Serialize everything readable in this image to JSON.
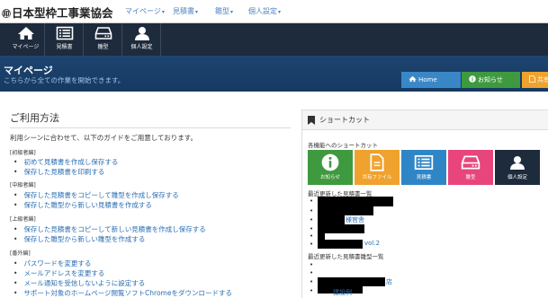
{
  "brand": {
    "seal": "㊞",
    "name": "日本型枠工事業協会"
  },
  "nav": [
    {
      "label": "マイページ"
    },
    {
      "label": "見積書"
    },
    {
      "label": "雛型"
    },
    {
      "label": "個人設定"
    }
  ],
  "iconbar": [
    {
      "label": "マイページ",
      "icon": "home-icon"
    },
    {
      "label": "見積書",
      "icon": "list-icon"
    },
    {
      "label": "雛型",
      "icon": "drive-icon"
    },
    {
      "label": "個人設定",
      "icon": "user-icon"
    }
  ],
  "header": {
    "title": "マイページ",
    "subtitle": "こちらから全ての作業を開始できます。",
    "buttons": [
      {
        "label": "Home",
        "color": "#3a87c8",
        "icon": "home-icon"
      },
      {
        "label": "お知らせ",
        "color": "#3f9a3f",
        "icon": "info-icon"
      },
      {
        "label": "共有",
        "color": "#f0a22e",
        "icon": "file-icon"
      }
    ]
  },
  "usage": {
    "heading": "ご利用方法",
    "intro": "利用シーンに合わせて、以下のガイドをご用意しております。",
    "sections": [
      {
        "title": "[初級者編]",
        "items": [
          "初めて見積書を作成し保存する",
          "保存した見積書を印刷する"
        ]
      },
      {
        "title": "[中級者編]",
        "items": [
          "保存した見積書をコピーして雛型を作成し保存する",
          "保存した雛型から新しい見積書を作成する"
        ]
      },
      {
        "title": "[上級者編]",
        "items": [
          "保存した見積書をコピーして新しい見積書を作成し保存する",
          "保存した雛型から新しい雛型を作成する"
        ]
      },
      {
        "title": "[番外編]",
        "items": [
          "パスワードを変更する",
          "メールアドレスを変更する",
          "メール通知を受信しないように設定する",
          "サポート対象のホームページ閲覧ソフトChromeをダウンロードする"
        ]
      }
    ]
  },
  "shortcut": {
    "title": "ショートカット",
    "all_label": "各機能へのショートカット",
    "buttons": [
      {
        "label": "お知らせ",
        "color": "#3f9a3f",
        "icon": "info-icon"
      },
      {
        "label": "共有ファイル",
        "color": "#f0a22e",
        "icon": "file-icon"
      },
      {
        "label": "見積書",
        "color": "#2f86c6",
        "icon": "list-icon"
      },
      {
        "label": "雛型",
        "color": "#e8457c",
        "icon": "drive-icon"
      },
      {
        "label": "個人設定",
        "color": "#1e2b3c",
        "icon": "user-icon"
      }
    ],
    "recent_estimates_label": "最近更新した見積書一覧",
    "recent_estimates": [
      "",
      "",
      "",
      "",
      "",
      "",
      ""
    ],
    "recent_estimate_visible_fragments": [
      "",
      "",
      "",
      "様官舎",
      "",
      "",
      "vol.2"
    ],
    "recent_templates_label": "最近更新した見積書雛型一覧",
    "recent_templates": [
      "",
      "",
      "",
      "",
      "",
      ""
    ],
    "recent_template_visible_fragments": [
      "",
      "",
      "",
      "店",
      "",
      "建設例"
    ]
  }
}
